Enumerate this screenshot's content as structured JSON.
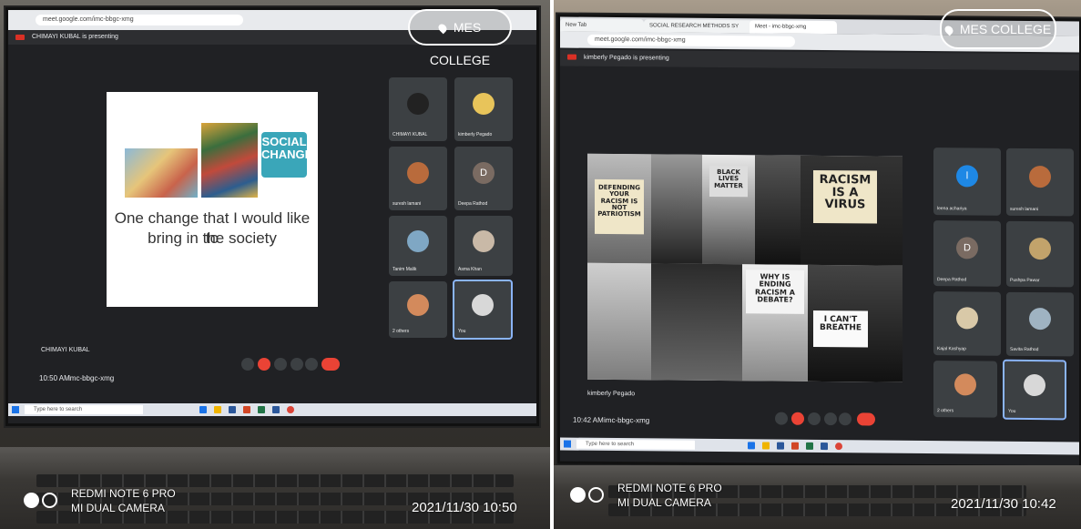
{
  "left_photo": {
    "url": "meet.google.com/imc-bbgc-xmg",
    "presenting_label": "CHIMAYI KUBAL is presenting",
    "location_badge": "MES COLLEGE",
    "slide": {
      "social_change_logo": "SOCIAL CHANGE",
      "text_line1": "One change that I would like to",
      "text_line2": "bring in the society"
    },
    "participants": [
      {
        "name": "CHIMAYI KUBAL"
      },
      {
        "name": "kimberly Pegado"
      },
      {
        "name": "suresh lamani"
      },
      {
        "name": "Deepa Rathod",
        "initial": "D"
      },
      {
        "name": "Tanim Malik"
      },
      {
        "name": "Asma Khan"
      },
      {
        "name": "2 others"
      },
      {
        "name": "You"
      }
    ],
    "presenter_label": "CHIMAYI KUBAL",
    "meeting_time": "10:50 AM",
    "meeting_code": "imc-bbgc-xmg",
    "taskbar_search": "Type here to search",
    "phone_model": "REDMI NOTE 6 PRO",
    "camera": "MI DUAL CAMERA",
    "timestamp": "2021/11/30  10:50"
  },
  "right_photo": {
    "url": "meet.google.com/imc-bbgc-xmg",
    "tab_labels": [
      "New Tab",
      "SOCIAL RESEARCH METHODS SY",
      "Meet - imc-bbgc-xmg"
    ],
    "presenting_label": "kimberly Pegado is presenting",
    "location_badge": "MES COLLEGE",
    "signs": {
      "racism": "RACISM IS A VIRUS",
      "debate": "WHY IS ENDING RACISM A DEBATE?",
      "breathe": "I CAN'T BREATHE",
      "patriotism": "DEFENDING YOUR RACISM IS NOT PATRIOTISM",
      "black_matter": "BLACK LIVES MATTER"
    },
    "participants": [
      {
        "name": "leena achariya",
        "initial": "l"
      },
      {
        "name": "suresh lamani"
      },
      {
        "name": "Deepa Rathod",
        "initial": "D"
      },
      {
        "name": "Pushpa Pawar"
      },
      {
        "name": "Kajal Kashyap"
      },
      {
        "name": "Savita Rathod"
      },
      {
        "name": "2 others"
      },
      {
        "name": "You"
      }
    ],
    "presenter_label": "kimberly Pegado",
    "meeting_time": "10:42 AM",
    "meeting_code": "imc-bbgc-xmg",
    "taskbar_search": "Type here to search",
    "phone_model": "REDMI NOTE 6 PRO",
    "camera": "MI DUAL CAMERA",
    "timestamp": "2021/11/30  10:42"
  },
  "colors": {
    "meet_bg": "#202124",
    "tile_bg": "#3c4043",
    "end_call": "#ea4335",
    "you_border": "#8ab4f8"
  }
}
